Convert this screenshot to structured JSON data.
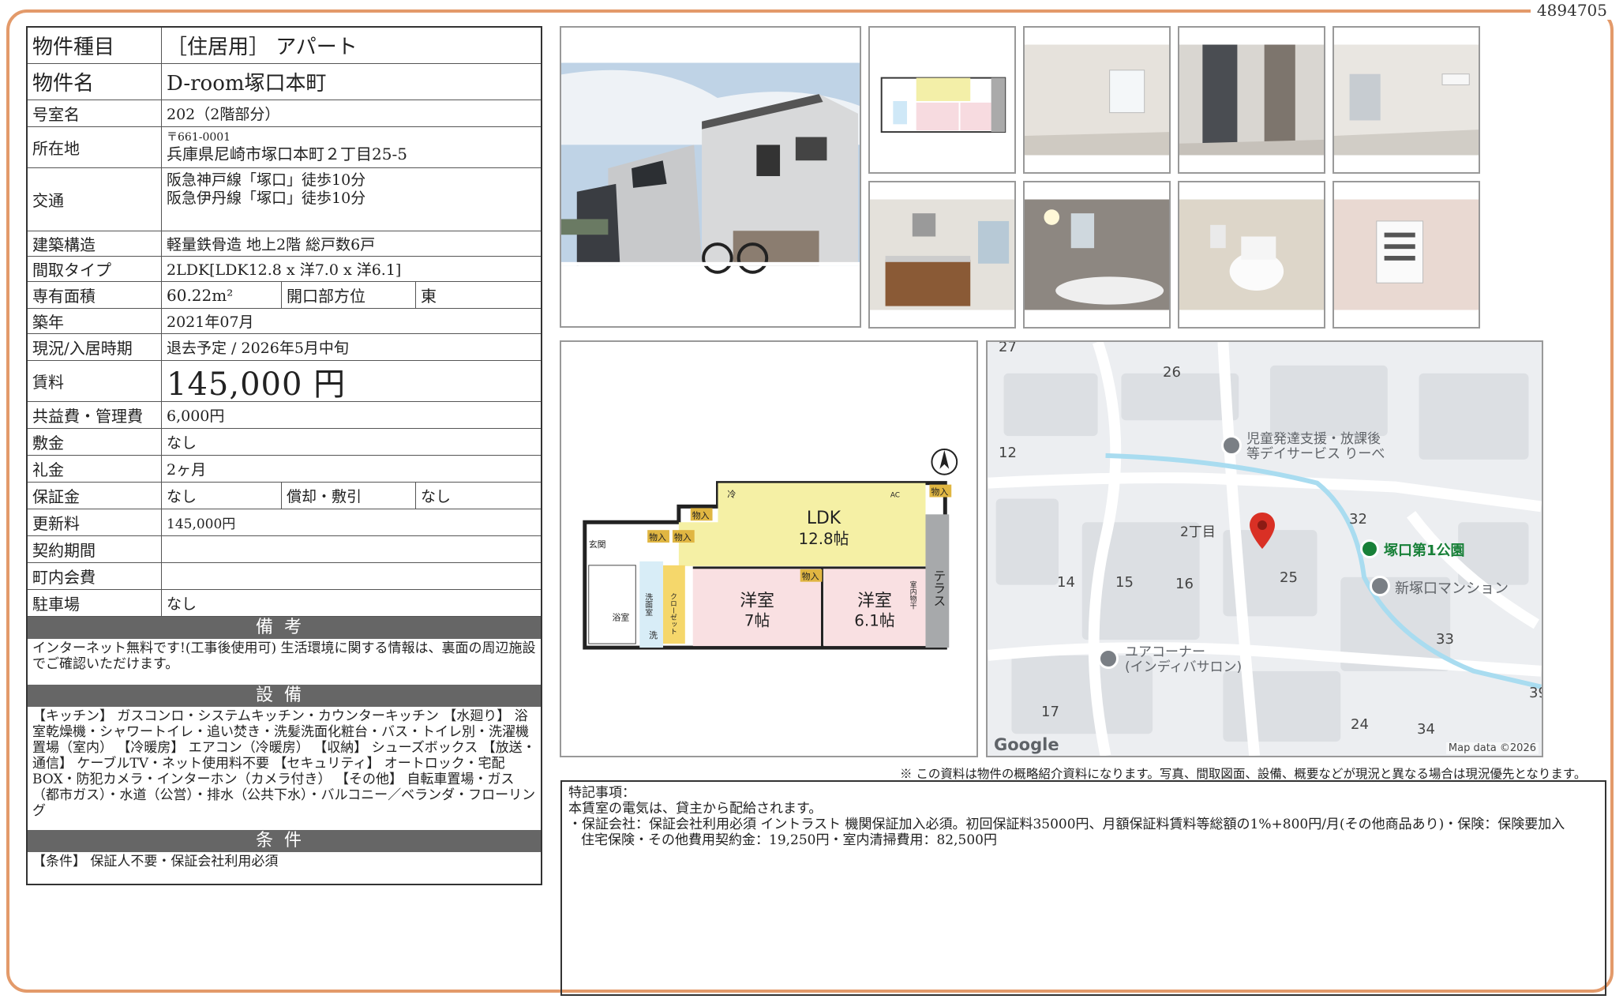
{
  "doc_id": "4894705",
  "spec": {
    "type_label": "物件種目",
    "type_value": "［住居用］ アパート",
    "name_label": "物件名",
    "name_value": "D-room塚口本町",
    "room_label": "号室名",
    "room_value": "202（2階部分）",
    "addr_label": "所在地",
    "addr_zip": "〒661-0001",
    "addr_value": "兵庫県尼崎市塚口本町２丁目25-5",
    "traffic_label": "交通",
    "traffic_1": "阪急神戸線「塚口」徒歩10分",
    "traffic_2": "阪急伊丹線「塚口」徒歩10分",
    "struct_label": "建築構造",
    "struct_value": "軽量鉄骨造 地上2階 総戸数6戸",
    "layout_label": "間取タイプ",
    "layout_value": "2LDK[LDK12.8 x 洋7.0 x 洋6.1]",
    "area_label": "専有面積",
    "area_value": "60.22m²",
    "facing_label": "開口部方位",
    "facing_value": "東",
    "built_label": "築年",
    "built_value": "2021年07月",
    "status_label": "現況/入居時期",
    "status_value": "退去予定 / 2026年5月中旬",
    "rent_label": "賃料",
    "rent_value": "145,000 円",
    "fee_label": "共益費・管理費",
    "fee_value": "6,000円",
    "deposit_label": "敷金",
    "deposit_value": "なし",
    "key_label": "礼金",
    "key_value": "2ヶ月",
    "guarantee_label": "保証金",
    "guarantee_value": "なし",
    "amort_label": "償却・敷引",
    "amort_value": "なし",
    "renewal_label": "更新料",
    "renewal_value": "145,000円",
    "contract_label": "契約期間",
    "contract_value": "",
    "town_label": "町内会費",
    "town_value": "",
    "parking_label": "駐車場",
    "parking_value": "なし"
  },
  "sections": {
    "remarks_head": "備考",
    "remarks_text": "インターネット無料です!(工事後使用可) 生活環境に関する情報は、裏面の周辺施設でご確認いただけます。",
    "equip_head": "設備",
    "equip_text": "【キッチン】 ガスコンロ・システムキッチン・カウンターキッチン 【水廻り】 浴室乾燥機・シャワートイレ・追い焚き・洗髪洗面化粧台・バス・トイレ別・洗濯機置場（室内） 【冷暖房】 エアコン（冷暖房） 【収納】 シューズボックス 【放送・通信】 ケーブルTV・ネット使用料不要 【セキュリティ】 オートロック・宅配BOX・防犯カメラ・インターホン（カメラ付き） 【その他】 自転車置場・ガス（都市ガス）・水道（公営）・排水（公共下水）・バルコニー／ベランダ・フローリング",
    "cond_head": "条件",
    "cond_text": "【条件】 保証人不要・保証会社利用必須"
  },
  "floorplan": {
    "ldk": "LDK",
    "ldk_size": "12.8帖",
    "room1": "洋室",
    "room1_size": "7帖",
    "room2": "洋室",
    "room2_size": "6.1帖",
    "terrace": "テラス",
    "storage": "物入",
    "entrance": "玄関",
    "bath": "浴室",
    "wash": "洗面室",
    "closet": "クローゼット",
    "indoor_storage": "室内物干",
    "ref": "冷",
    "wash_machine": "洗",
    "ac": "AC"
  },
  "map": {
    "labels": [
      "27",
      "26",
      "12",
      "2丁目",
      "32",
      "14",
      "15",
      "16",
      "25",
      "33",
      "17",
      "24",
      "34",
      "39"
    ],
    "poi_1": "児童発達支援・放課後",
    "poi_1b": "等デイサービス りーべ",
    "poi_park": "塚口第1公園",
    "poi_mansion": "新塚口マンション",
    "poi_salon": "ユアコーナー",
    "poi_salon_b": "(インディバサロン)",
    "logo": "Google",
    "attribution": "Map data ©2026"
  },
  "disclaimer": "※ この資料は物件の概略紹介資料になります。写真、間取図面、設備、概要などが現況と異なる場合は現況優先となります。",
  "special": {
    "title": "特記事項：",
    "line1": "本賃室の電気は、貸主から配給されます。",
    "line2": "・保証会社：保証会社利用必須 イントラスト 機関保証加入必須。初回保証料35000円、月額保証料賃料等総額の1%+800円/月(その他商品あり)・保険：保険要加入",
    "line3": "住宅保険・その他費用契約金：19,250円・室内清掃費用：82,500円"
  },
  "colors": {
    "frame": "#e39a6a",
    "header": "#666666",
    "pin": "#d93025",
    "park": "#188038"
  }
}
